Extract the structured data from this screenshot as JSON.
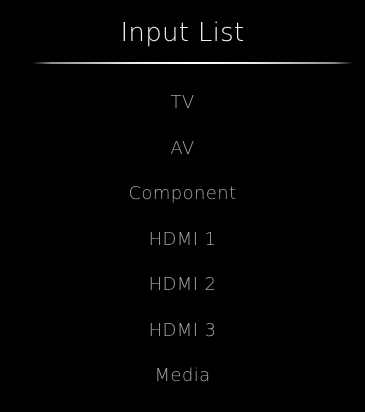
{
  "header": {
    "title": "Input List"
  },
  "inputs": [
    {
      "label": "TV"
    },
    {
      "label": "AV"
    },
    {
      "label": "Component"
    },
    {
      "label": "HDMI 1"
    },
    {
      "label": "HDMI 2"
    },
    {
      "label": "HDMI 3"
    },
    {
      "label": "Media"
    }
  ],
  "colors": {
    "background": "#000000",
    "title": "#f2f2f2",
    "item_text": "#a6a6a6",
    "divider": "#ffffff"
  }
}
